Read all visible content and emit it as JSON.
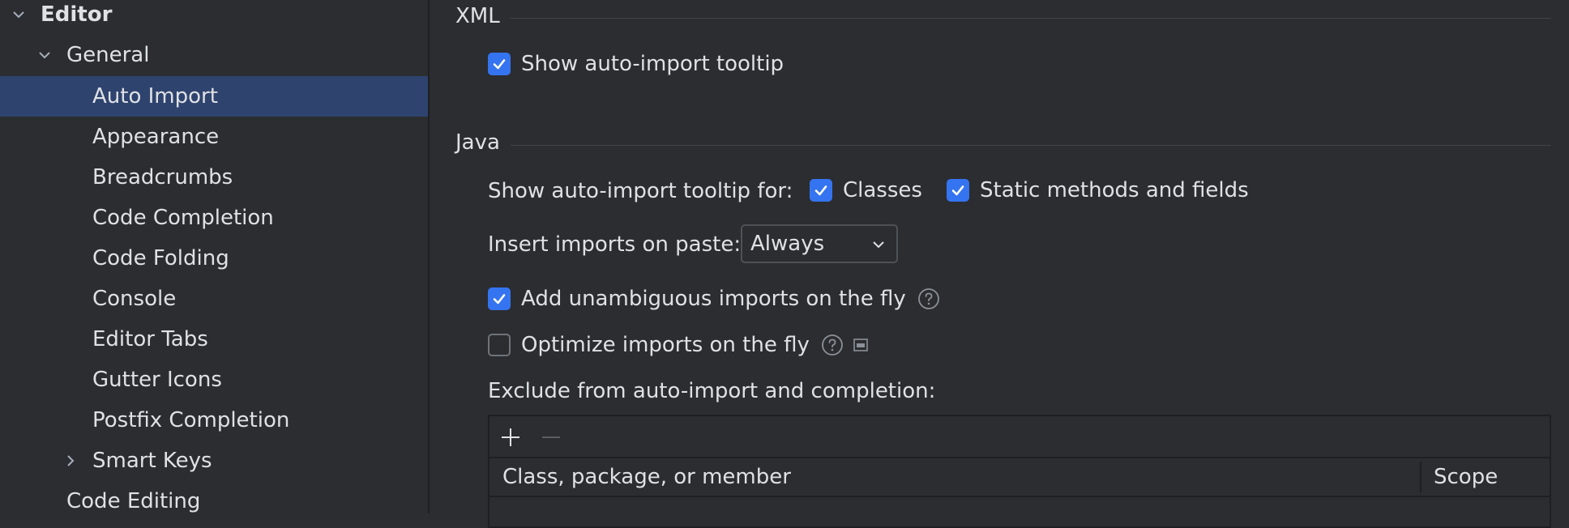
{
  "sidebar": {
    "items": [
      {
        "label": "Editor",
        "expanded": true,
        "icon": "chevron-down-icon"
      },
      {
        "label": "General",
        "expanded": true,
        "icon": "chevron-down-icon"
      },
      {
        "label": "Auto Import",
        "selected": true
      },
      {
        "label": "Appearance"
      },
      {
        "label": "Breadcrumbs"
      },
      {
        "label": "Code Completion"
      },
      {
        "label": "Code Folding"
      },
      {
        "label": "Console"
      },
      {
        "label": "Editor Tabs"
      },
      {
        "label": "Gutter Icons"
      },
      {
        "label": "Postfix Completion"
      },
      {
        "label": "Smart Keys",
        "expanded": false,
        "icon": "chevron-right-icon"
      },
      {
        "label": "Code Editing"
      }
    ]
  },
  "xml": {
    "title": "XML",
    "show_tooltip": {
      "label": "Show auto-import tooltip",
      "checked": true
    }
  },
  "java": {
    "title": "Java",
    "tooltip_for_label": "Show auto-import tooltip for:",
    "classes": {
      "label": "Classes",
      "checked": true
    },
    "static_methods": {
      "label": "Static methods and fields",
      "checked": true
    },
    "insert_on_paste_label": "Insert imports on paste:",
    "insert_on_paste_value": "Always",
    "add_unambiguous": {
      "label": "Add unambiguous imports on the fly",
      "checked": true
    },
    "optimize_imports": {
      "label": "Optimize imports on the fly",
      "checked": false
    },
    "exclude_label": "Exclude from auto-import and completion:",
    "exclude_table": {
      "columns": [
        "Class, package, or member",
        "Scope"
      ],
      "toolbar": [
        "plus-icon",
        "minus-icon"
      ],
      "rows": []
    }
  },
  "colors": {
    "background": "#2b2d30",
    "selection": "#2e436e",
    "accent": "#3574f0",
    "text": "#dfe1e5",
    "separator": "#43454a"
  }
}
